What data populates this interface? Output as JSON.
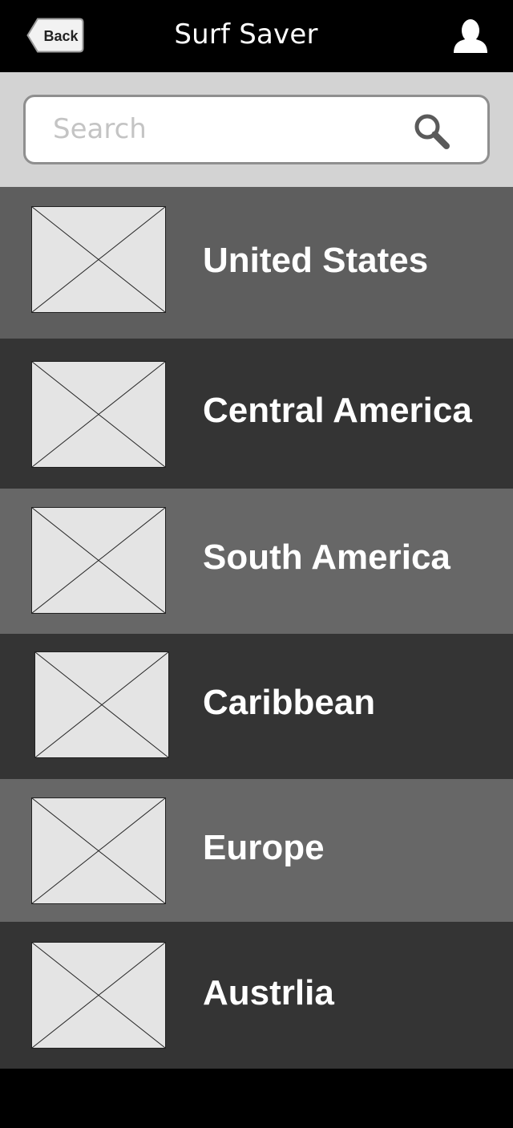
{
  "header": {
    "back_label": "Back",
    "title": "Surf Saver",
    "user_icon": "user-icon"
  },
  "search": {
    "placeholder": "Search",
    "value": "",
    "icon": "search-icon"
  },
  "regions": [
    {
      "label": "United States",
      "thumbnail": "image-placeholder-icon"
    },
    {
      "label": "Central America",
      "thumbnail": "image-placeholder-icon"
    },
    {
      "label": "South America",
      "thumbnail": "image-placeholder-icon"
    },
    {
      "label": "Caribbean",
      "thumbnail": "image-placeholder-icon"
    },
    {
      "label": "Europe",
      "thumbnail": "image-placeholder-icon"
    },
    {
      "label": "Austrlia",
      "thumbnail": "image-placeholder-icon"
    }
  ],
  "colors": {
    "navbar_bg": "#000000",
    "search_area_bg": "#d3d3d3",
    "row_bg_light": "#5e5e5e",
    "row_bg_dark": "#343434",
    "row_bg_mid": "#676767",
    "placeholder_fill": "#e4e4e4"
  }
}
